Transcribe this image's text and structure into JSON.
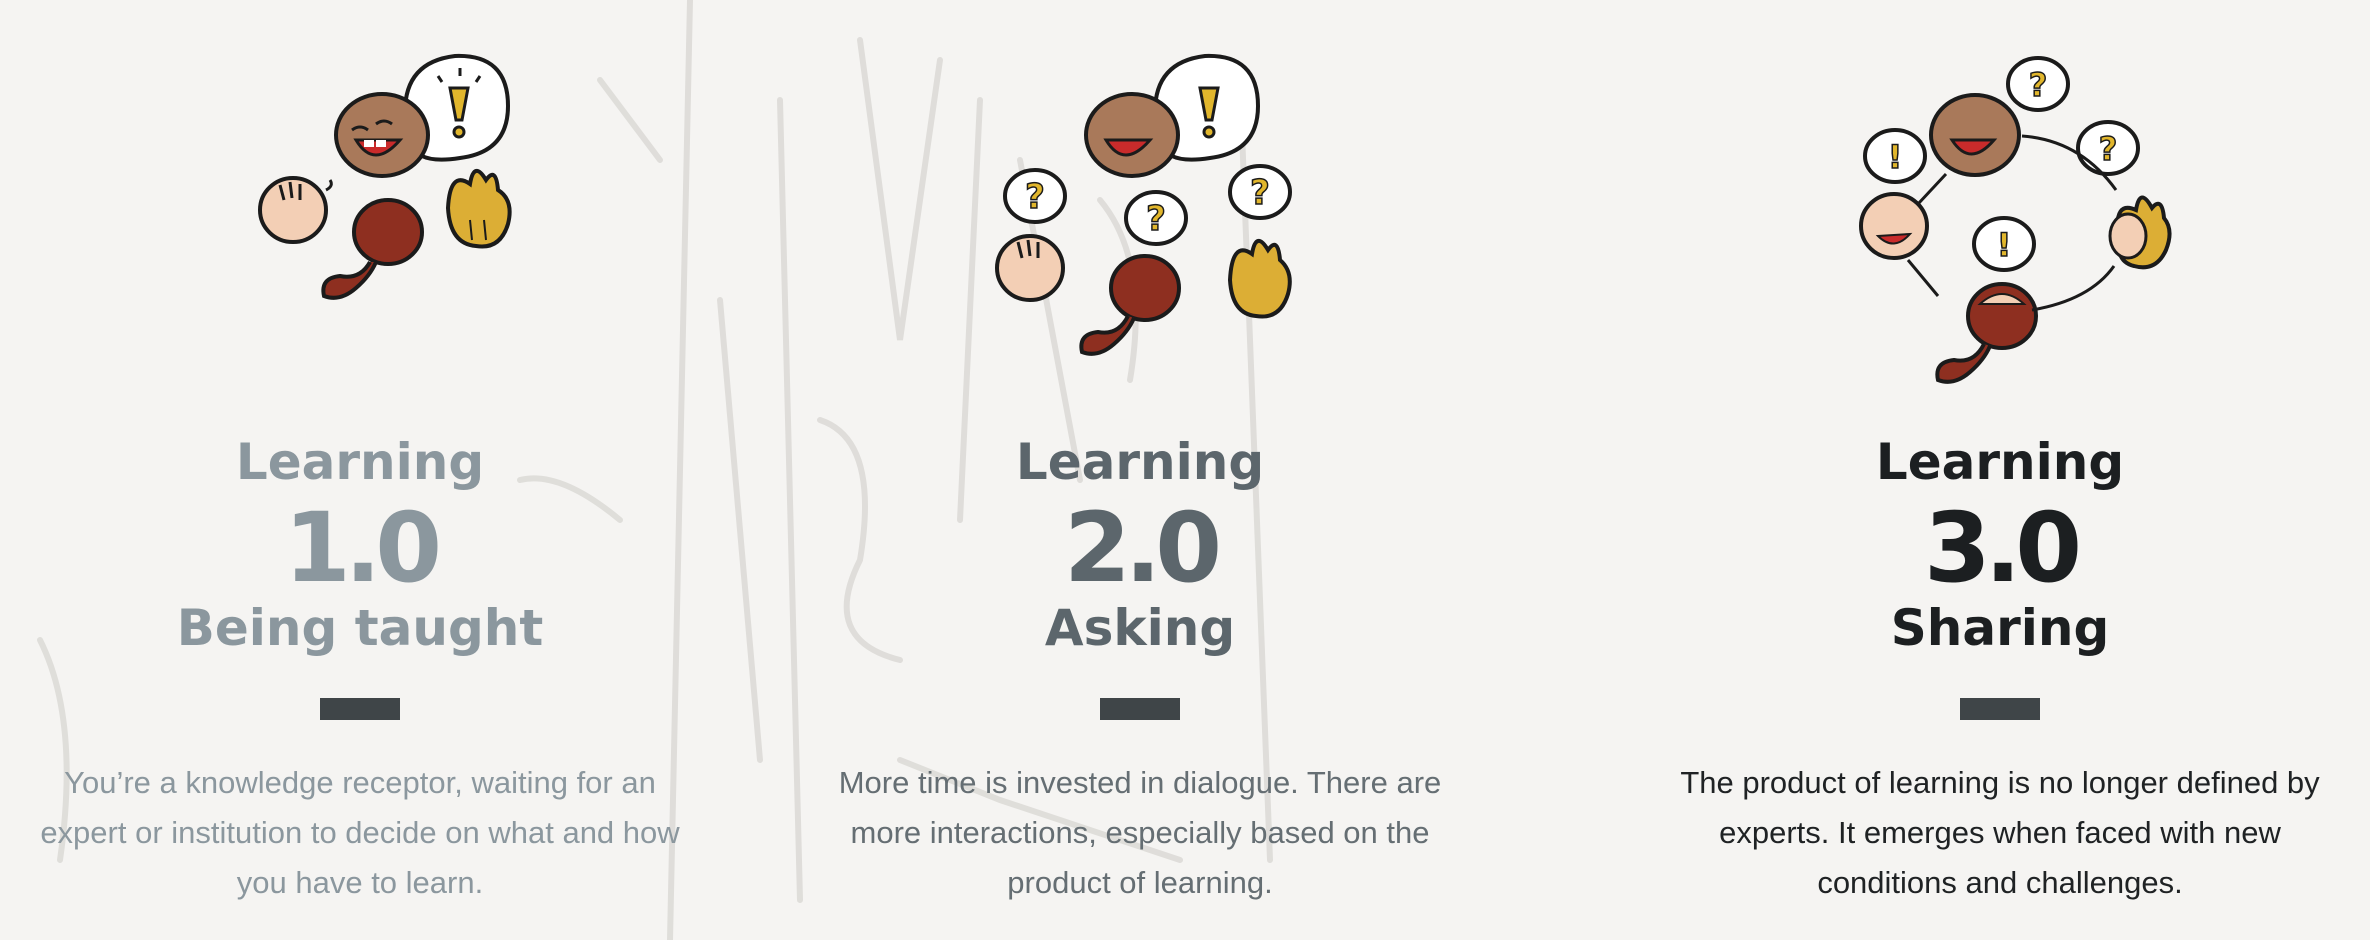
{
  "columns": [
    {
      "title": "Learning",
      "version": "1.0",
      "subtitle": "Being taught",
      "description": "You’re a knowledge receptor, waiting for an expert or institution to decide on what and how you have to learn."
    },
    {
      "title": "Learning",
      "version": "2.0",
      "subtitle": "Asking",
      "description": "More time is invested in dialogue. There are more interactions, especially based on the product of learning."
    },
    {
      "title": "Learning",
      "version": "3.0",
      "subtitle": "Sharing",
      "description": "The product of learning is no longer defined by experts. It emerges when faced with new conditions and challenges."
    }
  ],
  "colors": {
    "background": "#f5f4f2",
    "divider": "#3f4548",
    "brown_head": "#a9795a",
    "red_head": "#8e2f20",
    "yellow_head": "#dcae35",
    "peach_head": "#f3cfb5",
    "accent_yellow": "#e1b62c"
  },
  "icons": [
    "teacher-head-icon",
    "student-head-icon",
    "speech-bubble-icon",
    "question-mark-icon",
    "exclamation-mark-icon",
    "double-arrow-icon"
  ]
}
